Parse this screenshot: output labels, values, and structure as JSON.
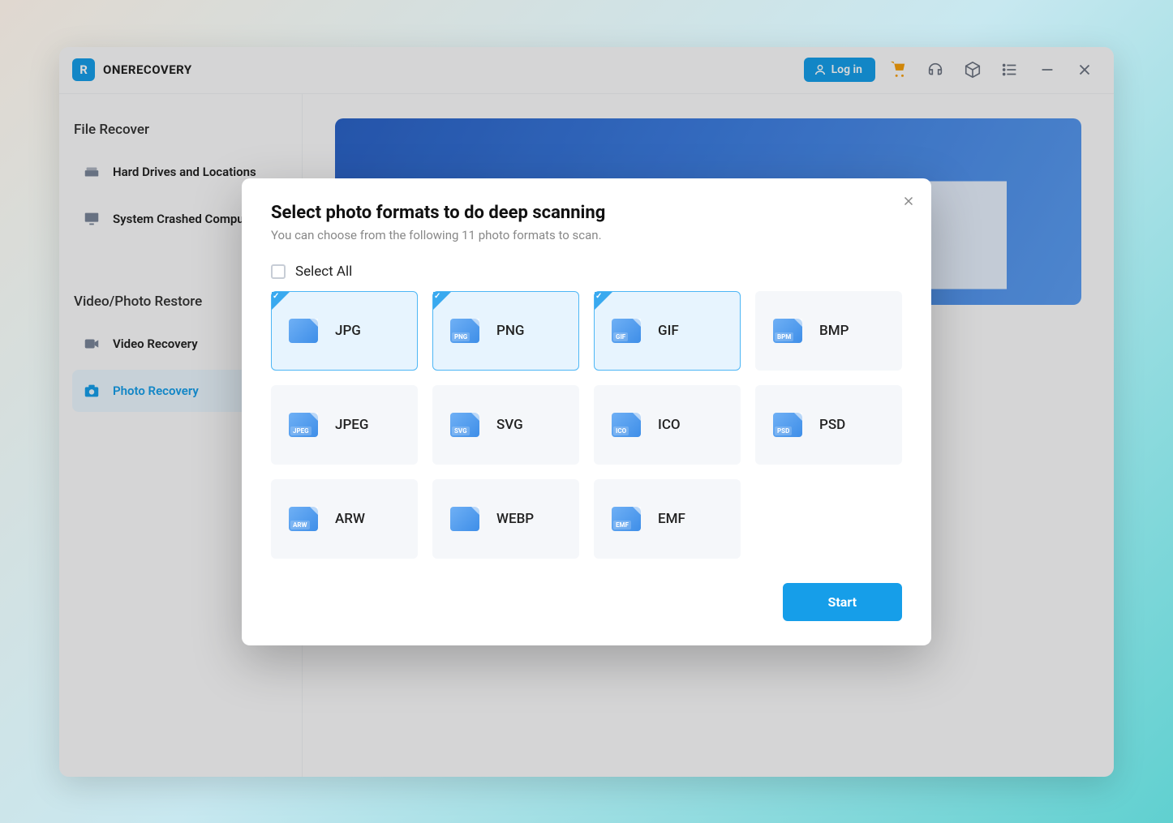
{
  "app": {
    "name": "ONERECOVERY",
    "logo_letter": "R"
  },
  "header": {
    "login_label": "Log in"
  },
  "sidebar": {
    "section1_title": "File Recover",
    "section2_title": "Video/Photo Restore",
    "items": [
      {
        "label": "Hard Drives and Locations",
        "active": false
      },
      {
        "label": "System Crashed Computer",
        "active": false
      },
      {
        "label": "Video Recovery",
        "active": false
      },
      {
        "label": "Photo Recovery",
        "active": true
      }
    ]
  },
  "modal": {
    "title": "Select photo formats to do deep scanning",
    "subtitle": "You can choose from the following 11 photo formats to scan.",
    "select_all_label": "Select All",
    "start_label": "Start",
    "formats": [
      {
        "code": "JPG",
        "tag": "",
        "selected": true
      },
      {
        "code": "PNG",
        "tag": "PNG",
        "selected": true
      },
      {
        "code": "GIF",
        "tag": "GIF",
        "selected": true
      },
      {
        "code": "BMP",
        "tag": "BPM",
        "selected": false
      },
      {
        "code": "JPEG",
        "tag": "JPEG",
        "selected": false
      },
      {
        "code": "SVG",
        "tag": "SVG",
        "selected": false
      },
      {
        "code": "ICO",
        "tag": "ICO",
        "selected": false
      },
      {
        "code": "PSD",
        "tag": "PSD",
        "selected": false
      },
      {
        "code": "ARW",
        "tag": "ARW",
        "selected": false
      },
      {
        "code": "WEBP",
        "tag": "",
        "selected": false
      },
      {
        "code": "EMF",
        "tag": "EMF",
        "selected": false
      }
    ]
  }
}
